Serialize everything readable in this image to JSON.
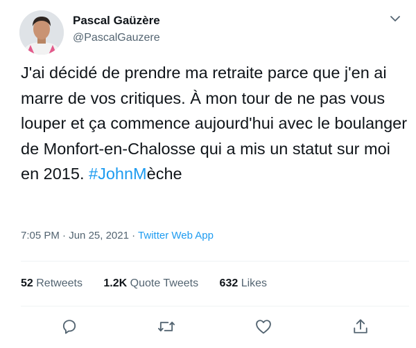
{
  "author": {
    "name": "Pascal Gaüzère",
    "handle": "@PascalGauzere",
    "more_icon": "chevron-down-icon",
    "avatar": "profile-photo"
  },
  "tweet": {
    "text_before": "J'ai décidé de prendre ma retraite parce que j'en ai marre de vos critiques. À mon tour de ne pas vous louper et ça commence aujourd'hui avec le boulanger de Monfort-en-Chalosse qui a mis un statut sur moi en 2015. ",
    "hashtag": "#JohnM",
    "text_after": "èche"
  },
  "meta": {
    "time": "7:05 PM",
    "sep1": " · ",
    "date": "Jun 25, 2021",
    "sep2": " · ",
    "source": "Twitter Web App"
  },
  "stats": {
    "retweets_count": "52",
    "retweets_label": "Retweets",
    "quotes_count": "1.2K",
    "quotes_label": "Quote Tweets",
    "likes_count": "632",
    "likes_label": "Likes"
  },
  "actions": {
    "reply_icon": "reply-icon",
    "retweet_icon": "retweet-icon",
    "like_icon": "heart-icon",
    "share_icon": "share-icon"
  },
  "colors": {
    "link": "#1d9bf0",
    "secondary_text": "#536471",
    "primary_text": "#0f1419",
    "divider": "#eff3f4"
  }
}
